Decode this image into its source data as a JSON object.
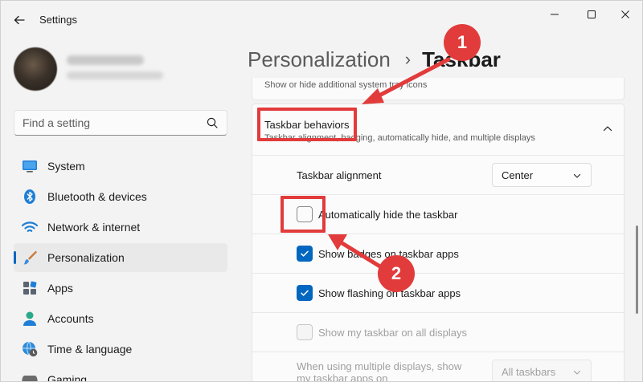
{
  "window": {
    "app_title": "Settings"
  },
  "sidebar": {
    "search_placeholder": "Find a setting",
    "items": [
      {
        "label": "System",
        "icon": "monitor-icon"
      },
      {
        "label": "Bluetooth & devices",
        "icon": "bluetooth-icon"
      },
      {
        "label": "Network & internet",
        "icon": "wifi-icon"
      },
      {
        "label": "Personalization",
        "icon": "brush-icon",
        "active": true
      },
      {
        "label": "Apps",
        "icon": "apps-icon"
      },
      {
        "label": "Accounts",
        "icon": "person-icon"
      },
      {
        "label": "Time & language",
        "icon": "globe-clock-icon"
      },
      {
        "label": "Gaming",
        "icon": "gamepad-icon"
      }
    ]
  },
  "breadcrumb": {
    "parent": "Personalization",
    "separator": "›",
    "current": "Taskbar"
  },
  "previous_card": {
    "text": "Show or hide additional system tray icons"
  },
  "behaviors": {
    "title": "Taskbar behaviors",
    "subtitle": "Taskbar alignment, badging, automatically hide, and multiple displays",
    "alignment_label": "Taskbar alignment",
    "alignment_value": "Center",
    "options": [
      {
        "label": "Automatically hide the taskbar",
        "checked": false,
        "disabled": false
      },
      {
        "label": "Show badges on taskbar apps",
        "checked": true,
        "disabled": false
      },
      {
        "label": "Show flashing on taskbar apps",
        "checked": true,
        "disabled": false
      },
      {
        "label": "Show my taskbar on all displays",
        "checked": false,
        "disabled": true
      }
    ],
    "multi_display_label": "When using multiple displays, show my taskbar apps on",
    "multi_display_value": "All taskbars"
  },
  "annotations": {
    "badge_1": "1",
    "badge_2": "2",
    "color": "#e23b3b"
  },
  "colors": {
    "accent": "#0067c0",
    "background": "#f3f3f3",
    "card": "#fbfbfb"
  }
}
